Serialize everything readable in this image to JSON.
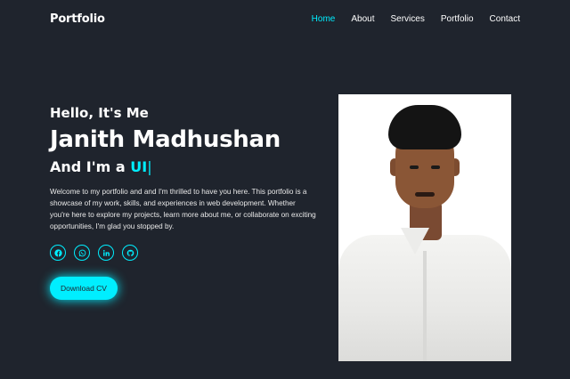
{
  "header": {
    "logo": "Portfolio",
    "nav": [
      {
        "label": "Home",
        "active": true
      },
      {
        "label": "About",
        "active": false
      },
      {
        "label": "Services",
        "active": false
      },
      {
        "label": "Portfolio",
        "active": false
      },
      {
        "label": "Contact",
        "active": false
      }
    ]
  },
  "hero": {
    "greeting": "Hello, It's Me",
    "name": "Janith Madhushan",
    "role_prefix": "And I'm a",
    "role_typed": "UI",
    "role_cursor": "|",
    "description": "Welcome to my portfolio and and I'm thrilled to have you here. This portfolio is a showcase of my work, skills, and experiences in web development. Whether you're here to explore my projects, learn more about me, or collaborate on exciting opportunities, I'm glad you stopped by.",
    "social": [
      {
        "icon": "facebook-icon"
      },
      {
        "icon": "whatsapp-icon"
      },
      {
        "icon": "linkedin-icon"
      },
      {
        "icon": "github-icon"
      }
    ],
    "cv_button": "Download CV"
  },
  "colors": {
    "background": "#1f242d",
    "accent": "#00eeff",
    "text": "#ffffff"
  }
}
